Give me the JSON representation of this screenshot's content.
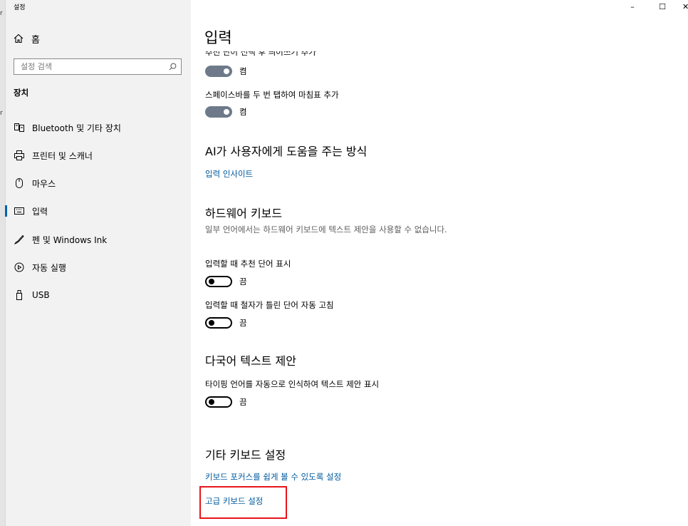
{
  "window": {
    "title": "설정",
    "controls": {
      "minimize": "–",
      "maximize": "☐",
      "close": "✕"
    }
  },
  "edge_fragments": [
    "r",
    "r"
  ],
  "sidebar": {
    "home_label": "홈",
    "search_placeholder": "설정 검색",
    "section_title": "장치",
    "items": [
      {
        "label": "Bluetooth 및 기타 장치",
        "icon": "bluetooth-devices-icon"
      },
      {
        "label": "프린터 및 스캐너",
        "icon": "printer-icon"
      },
      {
        "label": "마우스",
        "icon": "mouse-icon"
      },
      {
        "label": "입력",
        "icon": "keyboard-icon",
        "active": true
      },
      {
        "label": "펜 및 Windows Ink",
        "icon": "pen-icon"
      },
      {
        "label": "자동 실행",
        "icon": "autoplay-icon"
      },
      {
        "label": "USB",
        "icon": "usb-icon"
      }
    ]
  },
  "main": {
    "title": "입력",
    "clipped_label": "추천 단어 선택 후 띄어쓰기 추가",
    "toggle1_state": "켬",
    "setting2_label": "스페이스바를 두 번 탭하여 마침표 추가",
    "toggle2_state": "켬",
    "ai_heading": "AI가 사용자에게 도움을 주는 방식",
    "ai_link": "입력 인사이트",
    "hw_heading": "하드웨어 키보드",
    "hw_desc": "일부 언어에서는 하드웨어 키보드에 텍스트 제안을 사용할 수 없습니다.",
    "hw_setting1_label": "입력할 때 추천 단어 표시",
    "hw_toggle1_state": "끔",
    "hw_setting2_label": "입력할 때 철자가 틀린 단어 자동 고침",
    "hw_toggle2_state": "끔",
    "multi_heading": "다국어 텍스트 제안",
    "multi_setting_label": "타이핑 언어를 자동으로 인식하여 텍스트 제안 표시",
    "multi_toggle_state": "끔",
    "other_heading": "기타 키보드 설정",
    "other_link1": "키보드 포커스를 쉽게 볼 수 있도록 설정",
    "other_link2": "고급 키보드 설정"
  },
  "colors": {
    "link": "#005a9e",
    "toggle_on": "#6e7a8a",
    "highlight_box": "#e8141b",
    "sidebar_bg": "#f2f2f2"
  }
}
